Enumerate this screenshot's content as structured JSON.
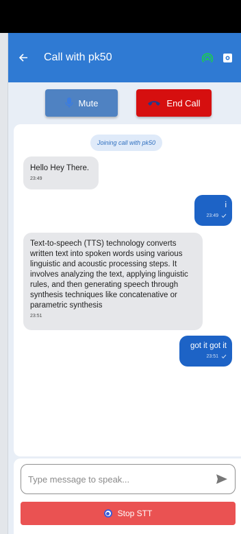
{
  "header": {
    "title": "Call with pk50"
  },
  "controls": {
    "mute_label": "Mute",
    "end_call_label": "End Call"
  },
  "chat": {
    "system_message": "Joining call with pk50",
    "messages": [
      {
        "text": "Hello Hey There.",
        "time": "23:49"
      },
      {
        "text": "i",
        "time": "23:49"
      },
      {
        "text": "Text-to-speech (TTS) technology converts written text into spoken words using various linguistic and acoustic processing steps. It involves analyzing the text, applying linguistic rules, and then generating speech through synthesis techniques like concatenative or parametric synthesis",
        "time": "23:51"
      },
      {
        "text": "got it got it",
        "time": "23:51"
      }
    ]
  },
  "composer": {
    "placeholder": "Type message to speak...",
    "stop_label": "Stop STT"
  },
  "icons": {
    "back": "back-arrow-icon",
    "signal": "signal-icon",
    "camera": "camera-icon",
    "mic": "mic-icon",
    "end_call": "phone-hangup-icon",
    "send": "send-icon",
    "check": "check-icon",
    "radio": "radio-icon"
  },
  "colors": {
    "appbar": "#2f7ad3",
    "mute": "#4f82c2",
    "end_call": "#d60f0f",
    "outgoing": "#1d63c6",
    "incoming": "#e6e7ea",
    "stop": "#ea5252",
    "signal": "#19d04a"
  }
}
